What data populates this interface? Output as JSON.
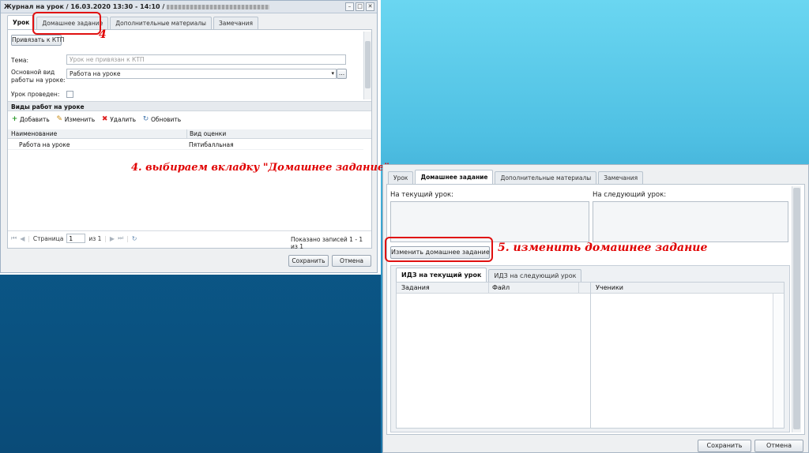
{
  "left_window": {
    "title": "Журнал на урок / 16.03.2020 13:30 - 14:10 /",
    "controls": [
      "–",
      "□",
      "✕"
    ],
    "tabs": [
      {
        "label": "Урок",
        "active": true
      },
      {
        "label": "Домашнее задание",
        "active": false
      },
      {
        "label": "Дополнительные материалы",
        "active": false
      },
      {
        "label": "Замечания",
        "active": false
      }
    ],
    "ktp_button": "Привязать к КТП",
    "topic_label": "Тема:",
    "topic_placeholder": "Урок не привязан к КТП",
    "work_type_label_1": "Основной вид",
    "work_type_label_2": "работы на уроке:",
    "work_type_value": "Работа на уроке",
    "work_type_more": "...",
    "lesson_done_label": "Урок проведен:",
    "section_title": "Виды работ на уроке",
    "toolbar": {
      "add": "Добавить",
      "edit": "Изменить",
      "delete": "Удалить",
      "refresh": "Обновить"
    },
    "grid_headers": [
      "Наименование",
      "Вид оценки"
    ],
    "grid_rows": [
      [
        "Работа на уроке",
        "Пятибалльная"
      ]
    ],
    "pager": {
      "page_label": "Страница",
      "page_value": "1",
      "of_label": "из 1",
      "records": "Показано записей 1 - 1 из 1"
    },
    "save": "Сохранить",
    "cancel": "Отмена"
  },
  "annotations": {
    "step4_number": "4",
    "step4_text": "4. выбираем вкладку \"Домашнее задание\"",
    "step5_text": "5. изменить домашнее задание"
  },
  "right_window": {
    "tabs": [
      {
        "label": "Урок",
        "active": false
      },
      {
        "label": "Домашнее задание",
        "active": true
      },
      {
        "label": "Дополнительные материалы",
        "active": false
      },
      {
        "label": "Замечания",
        "active": false
      }
    ],
    "current_label": "На текущий урок:",
    "next_label": "На следующий урок:",
    "change_button": "Изменить домашнее задание",
    "sub_tabs": [
      {
        "label": "ИДЗ на текущий урок",
        "active": true
      },
      {
        "label": "ИДЗ на следующий урок",
        "active": false
      }
    ],
    "grid_headers": [
      "Задания",
      "Файл",
      "Ученики"
    ],
    "save": "Сохранить",
    "cancel": "Отмена"
  },
  "colors": {
    "annotation": "#e00000",
    "desktop_left": "#0b5b8c",
    "desktop_right": "#4fc0e3"
  }
}
